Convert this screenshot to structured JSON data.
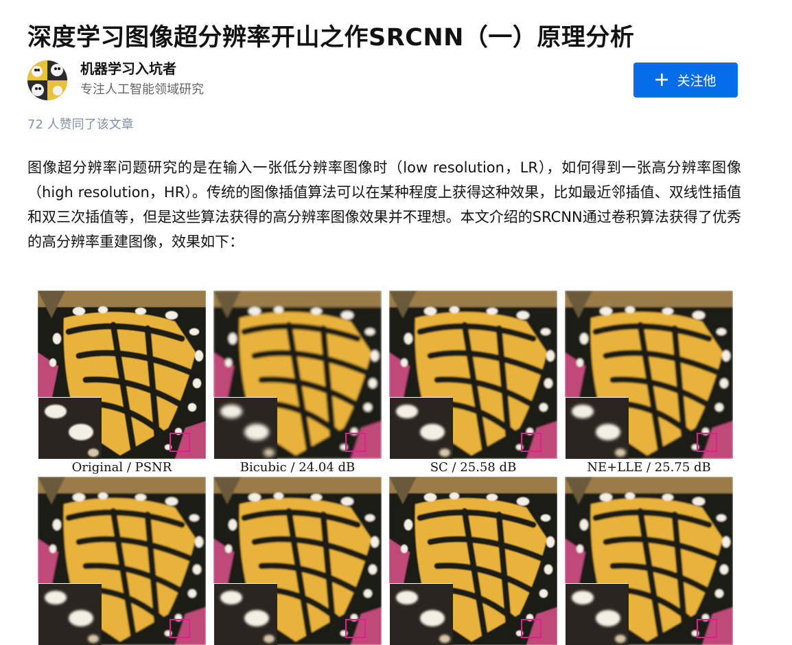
{
  "article": {
    "title": "深度学习图像超分辨率开山之作SRCNN（一）原理分析",
    "paragraph": "图像超分辨率问题研究的是在输入一张低分辨率图像时（low resolution，LR），如何得到一张高分辨率图像（high resolution，HR）。传统的图像插值算法可以在某种程度上获得这种效果，比如最近邻插值、双线性插值和双三次插值等，但是这些算法获得的高分辨率图像效果并不理想。本文介绍的SRCNN通过卷积算法获得了优秀的高分辨率重建图像，效果如下："
  },
  "author": {
    "name": "机器学习入坑者",
    "bio": "专注人工智能领域研究",
    "follow_label": "关注他",
    "follow_icon": "plus-icon"
  },
  "likes_text": "72 人赞同了该文章",
  "figure": {
    "captions": [
      "Original / PSNR",
      "Bicubic / 24.04 dB",
      "SC / 25.58 dB",
      "NE+LLE / 25.75 dB"
    ]
  },
  "colors": {
    "accent": "#056de8",
    "muted": "#8590a6",
    "butterfly_yellow": "#e9b33a",
    "butterfly_black": "#1d1a16",
    "flower_pink": "#c04a7a",
    "marker": "#e0208a"
  }
}
